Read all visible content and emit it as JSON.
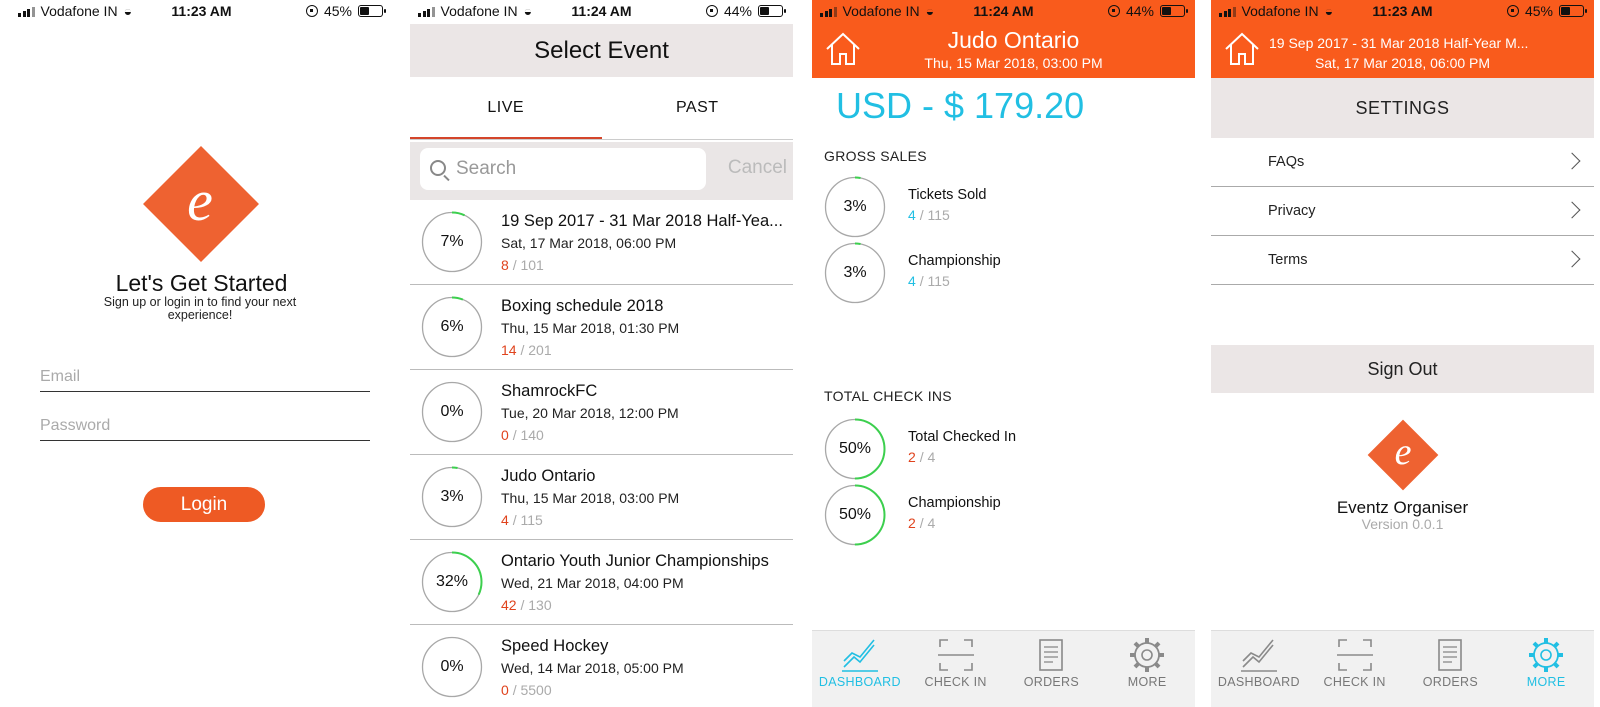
{
  "status_bars": [
    {
      "carrier": "Vodafone IN",
      "time": "11:23 AM",
      "battery": "45%"
    },
    {
      "carrier": "Vodafone IN",
      "time": "11:24 AM",
      "battery": "44%"
    },
    {
      "carrier": "Vodafone IN",
      "time": "11:24 AM",
      "battery": "44%"
    },
    {
      "carrier": "Vodafone IN",
      "time": "11:23 AM",
      "battery": "45%"
    }
  ],
  "login": {
    "logo_letter": "e",
    "title": "Let's Get Started",
    "subtitle": "Sign up or login in to find your next experience!",
    "email_placeholder": "Email",
    "password_placeholder": "Password",
    "login_label": "Login"
  },
  "select_event": {
    "title": "Select Event",
    "tabs": [
      {
        "label": "LIVE",
        "active": true
      },
      {
        "label": "PAST",
        "active": false
      }
    ],
    "search_placeholder": "Search",
    "cancel_label": "Cancel",
    "events": [
      {
        "percent": 7,
        "percent_label": "7%",
        "title": "19 Sep 2017 - 31 Mar 2018 Half-Yea...",
        "date": "Sat, 17 Mar 2018, 06:00 PM",
        "sold": "8",
        "total": "/ 101"
      },
      {
        "percent": 6,
        "percent_label": "6%",
        "title": "Boxing schedule 2018",
        "date": "Thu, 15 Mar 2018, 01:30 PM",
        "sold": "14",
        "total": "/ 201"
      },
      {
        "percent": 0,
        "percent_label": "0%",
        "title": "ShamrockFC",
        "date": "Tue, 20 Mar 2018, 12:00 PM",
        "sold": "0",
        "total": "/ 140"
      },
      {
        "percent": 3,
        "percent_label": "3%",
        "title": "Judo Ontario",
        "date": "Thu, 15 Mar 2018, 03:00 PM",
        "sold": "4",
        "total": "/ 115"
      },
      {
        "percent": 32,
        "percent_label": "32%",
        "title": "Ontario Youth Junior Championships",
        "date": "Wed, 21 Mar 2018, 04:00 PM",
        "sold": "42",
        "total": "/ 130"
      },
      {
        "percent": 0,
        "percent_label": "0%",
        "title": "Speed Hockey",
        "date": "Wed, 14 Mar 2018, 05:00 PM",
        "sold": "0",
        "total": "/ 5500"
      }
    ]
  },
  "dashboard": {
    "event_title": "Judo Ontario",
    "event_date": "Thu, 15 Mar 2018, 03:00 PM",
    "total": "USD - $ 179.20",
    "gross_sales_label": "GROSS SALES",
    "gross_sales": [
      {
        "percent": 3,
        "percent_label": "3%",
        "name": "Tickets Sold",
        "count": "4",
        "total": "/ 115"
      },
      {
        "percent": 3,
        "percent_label": "3%",
        "name": "Championship",
        "count": "4",
        "total": "/ 115"
      }
    ],
    "checkins_label": "TOTAL CHECK INS",
    "checkins": [
      {
        "percent": 50,
        "percent_label": "50%",
        "name": "Total Checked In",
        "count": "2",
        "total": "/ 4"
      },
      {
        "percent": 50,
        "percent_label": "50%",
        "name": "Championship",
        "count": "2",
        "total": "/ 4"
      }
    ]
  },
  "tabbar": {
    "items": [
      {
        "label": "DASHBOARD",
        "icon": "chart-line-icon"
      },
      {
        "label": "CHECK IN",
        "icon": "scan-frame-icon"
      },
      {
        "label": "ORDERS",
        "icon": "receipt-icon"
      },
      {
        "label": "MORE",
        "icon": "gear-icon"
      }
    ]
  },
  "settings": {
    "event_title": "19 Sep 2017 - 31 Mar 2018 Half-Year M...",
    "event_date": "Sat, 17 Mar 2018, 06:00 PM",
    "title": "SETTINGS",
    "menu": [
      {
        "label": "FAQs"
      },
      {
        "label": "Privacy"
      },
      {
        "label": "Terms"
      }
    ],
    "sign_out_label": "Sign Out",
    "logo_letter": "e",
    "app_name": "Eventz Organiser",
    "version": "Version 0.0.1"
  },
  "colors": {
    "brand_orange": "#f95b1c",
    "logo_orange": "#ee6231",
    "accent_cyan": "#21bfe3",
    "count_red": "#e0431d",
    "progress_green": "#3ccf4e",
    "ring_grey": "#a8a8a8"
  }
}
